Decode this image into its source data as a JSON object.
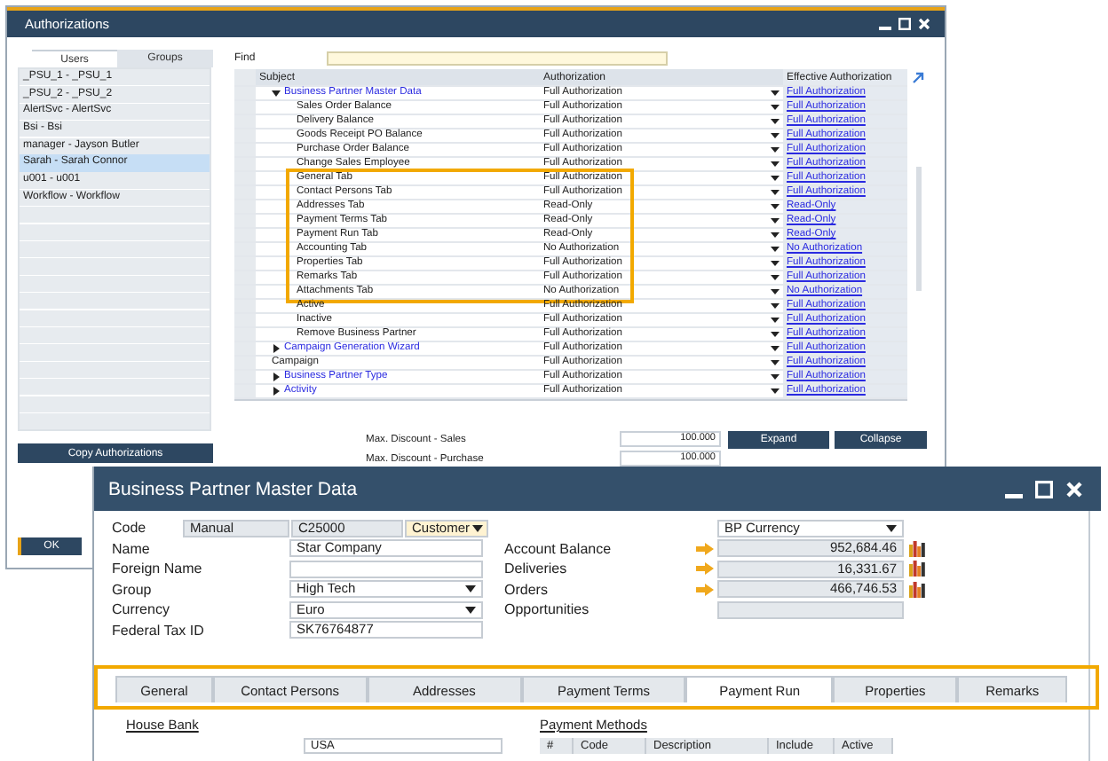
{
  "auth_window": {
    "title": "Authorizations",
    "tabs": [
      {
        "label": "Users",
        "selected": true
      },
      {
        "label": "Groups",
        "selected": false
      }
    ],
    "users": [
      {
        "label": "_PSU_1 - _PSU_1",
        "selected": false
      },
      {
        "label": "_PSU_2 - _PSU_2",
        "selected": false
      },
      {
        "label": "AlertSvc - AlertSvc",
        "selected": false
      },
      {
        "label": "Bsi - Bsi",
        "selected": false
      },
      {
        "label": "manager - Jayson Butler",
        "selected": false
      },
      {
        "label": "Sarah - Sarah Connor",
        "selected": true
      },
      {
        "label": "u001 - u001",
        "selected": false
      },
      {
        "label": "Workflow - Workflow",
        "selected": false
      }
    ],
    "copy_button": "Copy Authorizations",
    "find_label": "Find",
    "columns": [
      "Subject",
      "Authorization",
      "Effective Authorization"
    ],
    "rows": [
      {
        "subject": "Business Partner Master Data",
        "kind": "group",
        "expanded": true,
        "authorization": "Full Authorization",
        "effective": "Full Authorization",
        "children": [
          {
            "subject": "Sales Order Balance",
            "authorization": "Full Authorization",
            "effective": "Full Authorization",
            "highlighted": false
          },
          {
            "subject": "Delivery Balance",
            "authorization": "Full Authorization",
            "effective": "Full Authorization",
            "highlighted": false
          },
          {
            "subject": "Goods Receipt PO Balance",
            "authorization": "Full Authorization",
            "effective": "Full Authorization",
            "highlighted": false
          },
          {
            "subject": "Purchase Order Balance",
            "authorization": "Full Authorization",
            "effective": "Full Authorization",
            "highlighted": false
          },
          {
            "subject": "Change Sales Employee",
            "authorization": "Full Authorization",
            "effective": "Full Authorization",
            "highlighted": false
          },
          {
            "subject": "General Tab",
            "authorization": "Full Authorization",
            "effective": "Full Authorization",
            "highlighted": true
          },
          {
            "subject": "Contact Persons Tab",
            "authorization": "Full Authorization",
            "effective": "Full Authorization",
            "highlighted": true
          },
          {
            "subject": "Addresses Tab",
            "authorization": "Read-Only",
            "effective": "Read-Only",
            "highlighted": true
          },
          {
            "subject": "Payment Terms Tab",
            "authorization": "Read-Only",
            "effective": "Read-Only",
            "highlighted": true
          },
          {
            "subject": "Payment Run Tab",
            "authorization": "Read-Only",
            "effective": "Read-Only",
            "highlighted": true
          },
          {
            "subject": "Accounting Tab",
            "authorization": "No Authorization",
            "effective": "No Authorization",
            "highlighted": true
          },
          {
            "subject": "Properties Tab",
            "authorization": "Full Authorization",
            "effective": "Full Authorization",
            "highlighted": true
          },
          {
            "subject": "Remarks Tab",
            "authorization": "Full Authorization",
            "effective": "Full Authorization",
            "highlighted": true
          },
          {
            "subject": "Attachments Tab",
            "authorization": "No Authorization",
            "effective": "No Authorization",
            "highlighted": true
          },
          {
            "subject": "Active",
            "authorization": "Full Authorization",
            "effective": "Full Authorization",
            "highlighted": false
          },
          {
            "subject": "Inactive",
            "authorization": "Full Authorization",
            "effective": "Full Authorization",
            "highlighted": false
          },
          {
            "subject": "Remove Business Partner",
            "authorization": "Full Authorization",
            "effective": "Full Authorization",
            "highlighted": false
          }
        ]
      },
      {
        "subject": "Campaign Generation Wizard",
        "kind": "group",
        "expanded": false,
        "authorization": "Full Authorization",
        "effective": "Full Authorization"
      },
      {
        "subject": "Campaign",
        "kind": "item",
        "authorization": "Full Authorization",
        "effective": "Full Authorization"
      },
      {
        "subject": "Business Partner Type",
        "kind": "group",
        "expanded": false,
        "authorization": "Full Authorization",
        "effective": "Full Authorization"
      },
      {
        "subject": "Activity",
        "kind": "group",
        "expanded": false,
        "authorization": "Full Authorization",
        "effective": "Full Authorization"
      }
    ],
    "max_discounts": [
      {
        "label": "Max. Discount - Sales",
        "value": "100.000"
      },
      {
        "label": "Max. Discount - Purchase",
        "value": "100.000"
      }
    ],
    "expand_button": "Expand",
    "collapse_button": "Collapse",
    "ok_button": "OK"
  },
  "bp_window": {
    "title": "Business Partner Master Data",
    "code": {
      "label": "Code",
      "series": "Manual",
      "value": "C25000",
      "type": "Customer"
    },
    "fields": [
      {
        "label": "Name",
        "kind": "text",
        "value": "Star Company"
      },
      {
        "label": "Foreign Name",
        "kind": "text"
      },
      {
        "label": "Group",
        "kind": "select",
        "value": "High Tech"
      },
      {
        "label": "Currency",
        "kind": "select",
        "value": "Euro"
      },
      {
        "label": "Federal Tax ID",
        "kind": "text",
        "value": "SK76764877"
      }
    ],
    "currency_select": "BP Currency",
    "balances": [
      {
        "label": "Account Balance",
        "value": "952,684.46",
        "drilldown": true
      },
      {
        "label": "Deliveries",
        "value": "16,331.67",
        "drilldown": true
      },
      {
        "label": "Orders",
        "value": "466,746.53",
        "drilldown": true
      },
      {
        "label": "Opportunities",
        "drilldown": false
      }
    ],
    "tabs_highlighted": true,
    "tabs": [
      {
        "label": "General",
        "selected": false
      },
      {
        "label": "Contact Persons",
        "selected": false
      },
      {
        "label": "Addresses",
        "selected": false
      },
      {
        "label": "Payment Terms",
        "selected": false
      },
      {
        "label": "Payment Run",
        "selected": true
      },
      {
        "label": "Properties",
        "selected": false
      },
      {
        "label": "Remarks",
        "selected": false
      }
    ],
    "house_bank": {
      "title": "House Bank",
      "country": "USA"
    },
    "payment_methods": {
      "title": "Payment Methods",
      "columns": [
        "#",
        "Code",
        "Description",
        "Include",
        "Active"
      ]
    }
  }
}
